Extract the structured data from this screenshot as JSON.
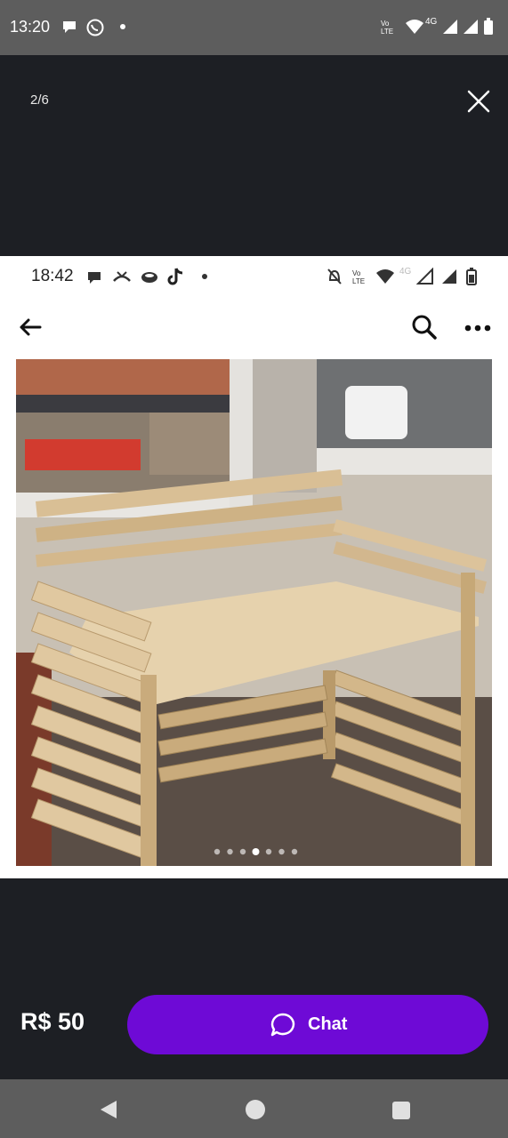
{
  "status_bar": {
    "time": "13:20",
    "network": "4G"
  },
  "viewer": {
    "counter": "2/6"
  },
  "screenshot": {
    "status_bar": {
      "time": "18:42",
      "network": "4G"
    },
    "photo": {
      "dot_count": 7,
      "active_dot": 3
    }
  },
  "listing": {
    "price": "R$ 50",
    "chat_label": "Chat"
  },
  "colors": {
    "accent": "#6e0ad6",
    "background": "#1d1f24",
    "system_bar": "#5d5d5d"
  },
  "icons": [
    "message-icon",
    "whatsapp-icon",
    "volte-icon",
    "wifi-icon",
    "signal-icon",
    "battery-icon",
    "close-icon",
    "back-arrow-icon",
    "search-icon",
    "more-icon",
    "chat-bubble-icon",
    "nav-back-icon",
    "nav-home-icon",
    "nav-recents-icon",
    "tiktok-icon",
    "mute-icon"
  ]
}
